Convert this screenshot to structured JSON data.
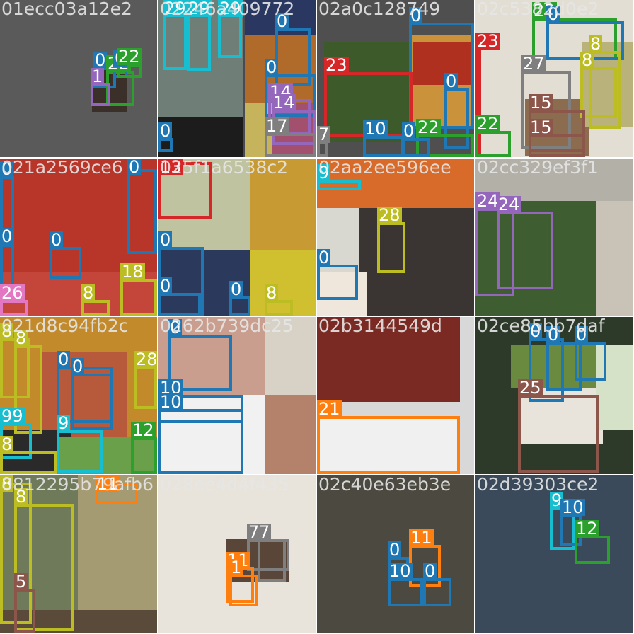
{
  "colors": {
    "0": "#1f77b4",
    "1": "#9467bd",
    "7": "#7f7f7f",
    "8": "#bcbd22",
    "9": "#17becf",
    "10": "#1f77b4",
    "11": "#ff7f0e",
    "12": "#2ca02c",
    "13": "#d62728",
    "14": "#9467bd",
    "15": "#8c564b",
    "17": "#7f7f7f",
    "18": "#bcbd22",
    "21": "#ff7f0e",
    "22": "#2ca02c",
    "23": "#d62728",
    "24": "#9467bd",
    "25": "#8c564b",
    "26": "#e377c2",
    "27": "#7f7f7f",
    "28": "#bcbd22",
    "29": "#17becf"
  },
  "tiles": [
    {
      "title": "01ecc03a12e2",
      "bg": "#727272",
      "photos": [
        {
          "fill": "#5a5a5a"
        },
        {
          "fill": "#3b2f2a"
        }
      ],
      "boxes": [
        {
          "cls": "0",
          "text": "0"
        },
        {
          "cls": "22",
          "text": "22"
        },
        {
          "cls": "1",
          "text": "1"
        },
        {
          "cls": "0",
          "text": "0"
        },
        {
          "cls": "22",
          "text": "22"
        }
      ]
    },
    {
      "title": "02246a409772",
      "bg": "#4a4a52",
      "photos": [
        {
          "fill": "#6f7f78"
        },
        {
          "fill": "#2a3760"
        },
        {
          "fill": "#b06a2a"
        },
        {
          "fill": "#c5b45c"
        },
        {
          "fill": "#a34f6e"
        },
        {
          "fill": "#1c1c1c"
        }
      ],
      "boxes": [
        {
          "cls": "29",
          "text": "29"
        },
        {
          "cls": "29",
          "text": "29"
        },
        {
          "cls": "29",
          "text": "29"
        },
        {
          "cls": "0",
          "text": "0"
        },
        {
          "cls": "0",
          "text": "0"
        },
        {
          "cls": "14",
          "text": "14"
        },
        {
          "cls": "14",
          "text": "14"
        },
        {
          "cls": "17",
          "text": "17"
        },
        {
          "cls": "0",
          "text": "0"
        }
      ]
    },
    {
      "title": "02a0c128749",
      "bg": "#727272",
      "photos": [
        {
          "fill": "#4f4f4f"
        },
        {
          "fill": "#3d5a2a"
        },
        {
          "fill": "#c9923b"
        },
        {
          "fill": "#b03020"
        }
      ],
      "boxes": [
        {
          "cls": "0",
          "text": "0"
        },
        {
          "cls": "23",
          "text": "23"
        },
        {
          "cls": "0",
          "text": "0"
        },
        {
          "cls": "10",
          "text": "10"
        },
        {
          "cls": "22",
          "text": "22"
        },
        {
          "cls": "0",
          "text": "0"
        },
        {
          "cls": "7",
          "text": "7"
        }
      ]
    },
    {
      "title": "02c5382d0e2",
      "bg": "#cfcfcf",
      "photos": [
        {
          "fill": "#e2ded4"
        },
        {
          "fill": "#8b6c4e"
        },
        {
          "fill": "#b9b27a"
        }
      ],
      "boxes": [
        {
          "cls": "23",
          "text": "23"
        },
        {
          "cls": "22",
          "text": "22"
        },
        {
          "cls": "0",
          "text": "0"
        },
        {
          "cls": "8",
          "text": "8"
        },
        {
          "cls": "27",
          "text": "27"
        },
        {
          "cls": "8",
          "text": "8"
        },
        {
          "cls": "15",
          "text": "15"
        },
        {
          "cls": "22",
          "text": "22"
        },
        {
          "cls": "15",
          "text": "15"
        }
      ]
    },
    {
      "title": "021a2569ce6",
      "bg": "#8a1a14",
      "photos": [
        {
          "fill": "#b8352a"
        },
        {
          "fill": "#c4463a"
        }
      ],
      "boxes": [
        {
          "cls": "0",
          "text": "0"
        },
        {
          "cls": "0",
          "text": "0"
        },
        {
          "cls": "0",
          "text": "0"
        },
        {
          "cls": "0",
          "text": "0"
        },
        {
          "cls": "18",
          "text": "18"
        },
        {
          "cls": "8",
          "text": "8"
        },
        {
          "cls": "26",
          "text": "26"
        }
      ]
    },
    {
      "title": "025f1a6538c2",
      "bg": "#3c3c3c",
      "photos": [
        {
          "fill": "#bfc3a0"
        },
        {
          "fill": "#c89a34"
        },
        {
          "fill": "#2b3a5c"
        },
        {
          "fill": "#d0c030"
        }
      ],
      "boxes": [
        {
          "cls": "13",
          "text": "13"
        },
        {
          "cls": "0",
          "text": "0"
        },
        {
          "cls": "0",
          "text": "0"
        },
        {
          "cls": "0",
          "text": "0"
        },
        {
          "cls": "8",
          "text": "8"
        }
      ]
    },
    {
      "title": "02aa2ee596ee",
      "bg": "#4a4340",
      "photos": [
        {
          "fill": "#d86a2a"
        },
        {
          "fill": "#d8d8d0"
        },
        {
          "fill": "#3a3532"
        },
        {
          "fill": "#efe6dc"
        }
      ],
      "boxes": [
        {
          "cls": "9",
          "text": "9"
        },
        {
          "cls": "28",
          "text": "28"
        },
        {
          "cls": "0",
          "text": "0"
        }
      ]
    },
    {
      "title": "02cc329ef3f1",
      "bg": "#8c8c88",
      "photos": [
        {
          "fill": "#b3b0a8"
        },
        {
          "fill": "#3e5e32"
        },
        {
          "fill": "#c9c2b6"
        }
      ],
      "boxes": [
        {
          "cls": "24",
          "text": "24"
        },
        {
          "cls": "24",
          "text": "24"
        }
      ]
    },
    {
      "title": "021d8c94fb2c",
      "bg": "#6b5a2a",
      "photos": [
        {
          "fill": "#c28a2a"
        },
        {
          "fill": "#b75a3c"
        },
        {
          "fill": "#2a2a2a"
        },
        {
          "fill": "#6aa04a"
        }
      ],
      "boxes": [
        {
          "cls": "8",
          "text": "8"
        },
        {
          "cls": "8",
          "text": "8"
        },
        {
          "cls": "0",
          "text": "0"
        },
        {
          "cls": "0",
          "text": "0"
        },
        {
          "cls": "28",
          "text": "28"
        },
        {
          "cls": "9",
          "text": "99"
        },
        {
          "cls": "9",
          "text": "9"
        },
        {
          "cls": "12",
          "text": "12"
        },
        {
          "cls": "8",
          "text": "8"
        }
      ]
    },
    {
      "title": "0262b739dc25",
      "bg": "#e9e3da",
      "photos": [
        {
          "fill": "#c99e8e"
        },
        {
          "fill": "#d8d2c6"
        },
        {
          "fill": "#f1f1f1"
        },
        {
          "fill": "#b4826a"
        }
      ],
      "boxes": [
        {
          "cls": "0",
          "text": "0"
        },
        {
          "cls": "10",
          "text": "10"
        },
        {
          "cls": "10",
          "text": "10"
        }
      ]
    },
    {
      "title": "02b3144549d",
      "bg": "#141820",
      "photos": [
        {
          "fill": "#d8d8d8"
        },
        {
          "fill": "#7a2a22"
        },
        {
          "fill": "#f0f0f0"
        }
      ],
      "boxes": [
        {
          "cls": "21",
          "text": "21"
        }
      ]
    },
    {
      "title": "02ce85bb7daf",
      "bg": "#8c8c8c",
      "photos": [
        {
          "fill": "#2d3a2a"
        },
        {
          "fill": "#6a8a40"
        },
        {
          "fill": "#e8e4dc"
        },
        {
          "fill": "#d6e2c8"
        }
      ],
      "boxes": [
        {
          "cls": "0",
          "text": "0"
        },
        {
          "cls": "0",
          "text": "0"
        },
        {
          "cls": "0",
          "text": "0"
        },
        {
          "cls": "25",
          "text": "25"
        }
      ]
    },
    {
      "title": "0812295b79afb6",
      "bg": "#8a7a50",
      "photos": [
        {
          "fill": "#a59b72"
        },
        {
          "fill": "#6f7a5a"
        },
        {
          "fill": "#5a4a3a"
        }
      ],
      "boxes": [
        {
          "cls": "8",
          "text": "8"
        },
        {
          "cls": "8",
          "text": "8"
        },
        {
          "cls": "11",
          "text": "11"
        },
        {
          "cls": "15",
          "text": "5"
        }
      ]
    },
    {
      "title": "028ee4d4f435",
      "bg": "#8f8f8f",
      "photos": [
        {
          "fill": "#e8e4dc"
        },
        {
          "fill": "#5a4638"
        }
      ],
      "boxes": [
        {
          "cls": "7",
          "text": "7"
        },
        {
          "cls": "11",
          "text": "11"
        },
        {
          "cls": "11",
          "text": "1"
        },
        {
          "cls": "7",
          "text": "7"
        }
      ]
    },
    {
      "title": "02c40e63eb3e",
      "bg": "#6f6f6f",
      "photos": [
        {
          "fill": "#4c4a40"
        }
      ],
      "boxes": [
        {
          "cls": "11",
          "text": "11"
        },
        {
          "cls": "0",
          "text": "0"
        },
        {
          "cls": "10",
          "text": "10"
        },
        {
          "cls": "0",
          "text": "0"
        }
      ]
    },
    {
      "title": "02d39303ce2",
      "bg": "#8f8f8f",
      "photos": [
        {
          "fill": "#3a4a5a"
        }
      ],
      "boxes": [
        {
          "cls": "9",
          "text": "9"
        },
        {
          "cls": "10",
          "text": "10"
        },
        {
          "cls": "12",
          "text": "12"
        }
      ]
    }
  ]
}
